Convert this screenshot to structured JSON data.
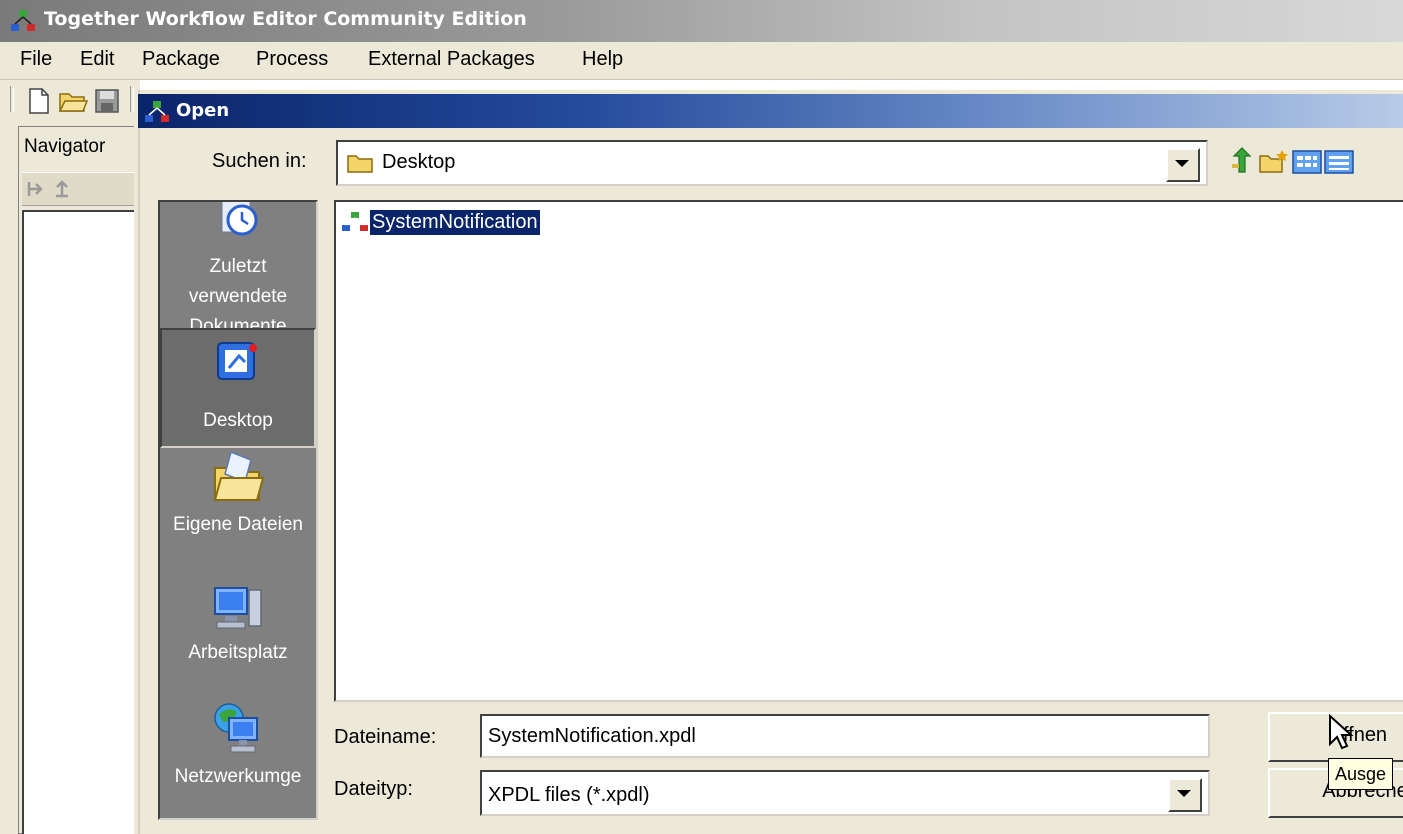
{
  "window": {
    "title": "Together Workflow Editor Community Edition"
  },
  "menu": [
    {
      "label": "File"
    },
    {
      "label": "Edit"
    },
    {
      "label": "Package"
    },
    {
      "label": "Process"
    },
    {
      "label": "External Packages"
    },
    {
      "label": "Help"
    }
  ],
  "toolbar": {
    "icons": [
      "new-icon",
      "open-folder-icon",
      "save-icon"
    ]
  },
  "navigator": {
    "title": "Navigator",
    "icons": [
      "forward-icon",
      "up-icon"
    ]
  },
  "dialog": {
    "title": "Open",
    "look_in": {
      "label": "Suchen in:",
      "value": "Desktop"
    },
    "places": [
      {
        "label": "Zuletzt verwendete Dokumente",
        "icon": "recent-documents-icon"
      },
      {
        "label": "Desktop",
        "icon": "desktop-icon",
        "selected": true
      },
      {
        "label": "Eigene Dateien",
        "icon": "my-documents-icon"
      },
      {
        "label": "Arbeitsplatz",
        "icon": "my-computer-icon"
      },
      {
        "label": "Netzwerkumge",
        "icon": "network-icon"
      }
    ],
    "files": [
      {
        "name": "SystemNotification",
        "icon": "workflow-icon",
        "selected": true
      }
    ],
    "filename": {
      "label": "Dateiname:",
      "value": "SystemNotification.xpdl"
    },
    "filetype": {
      "label": "Dateityp:",
      "value": "XPDL files (*.xpdl)"
    },
    "buttons": {
      "open": "ffnen",
      "cancel": "Abbreche"
    },
    "tooltip": "Ausge"
  },
  "colors": {
    "selection": "#0a246a",
    "dialog_bg": "#ece9d8",
    "places_bg": "#808080"
  }
}
